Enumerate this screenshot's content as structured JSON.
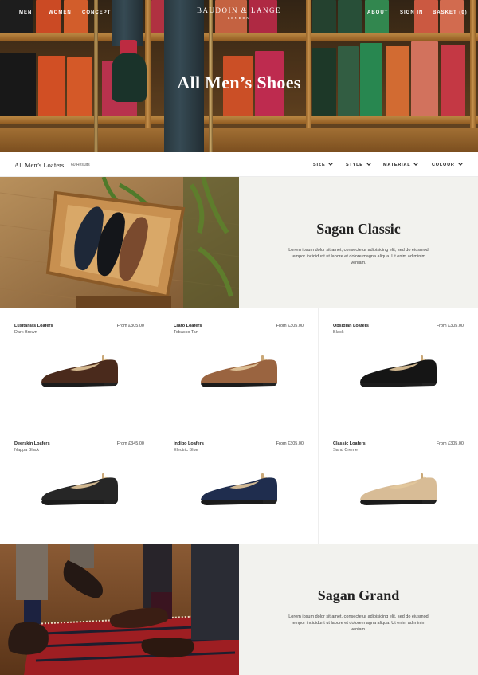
{
  "nav": {
    "left": [
      "MEN",
      "WOMEN",
      "CONCEPT"
    ],
    "right": [
      "ABOUT",
      "SIGN IN",
      "BASKET (0)"
    ],
    "brand_name": "BAUDOIN & LANGE",
    "brand_sub": "LONDON"
  },
  "hero": {
    "title": "All Men’s Shoes"
  },
  "filterbar": {
    "heading": "All Men’s Loafers",
    "count": "60 Results",
    "filters": [
      "SIZE",
      "STYLE",
      "MATERIAL",
      "COLOUR"
    ]
  },
  "features": [
    {
      "title": "Sagan Classic",
      "description": "Lorem ipsum dolor sit amet, consectetur adipisicing elit, sed do eiusmod tempor incididunt ut labore et dolore magna aliqua. Ut enim ad minim veniam."
    },
    {
      "title": "Sagan Grand",
      "description": "Lorem ipsum dolor sit amet, consectetur adipisicing elit, sed do eiusmod tempor incididunt ut labore et dolore magna aliqua. Ut enim ad minim veniam."
    }
  ],
  "products": [
    {
      "name": "Lusitanias Loafers",
      "color": "Dark Brown",
      "price": "From £305.00",
      "swatch": "#4a2a1c"
    },
    {
      "name": "Claro Loafers",
      "color": "Tobacco Tan",
      "price": "From £305.00",
      "swatch": "#9a6440"
    },
    {
      "name": "Obsidian Loafers",
      "color": "Black",
      "price": "From £305.00",
      "swatch": "#151515"
    },
    {
      "name": "Deerskin Loafers",
      "color": "Nappa Black",
      "price": "From £345.00",
      "swatch": "#262626"
    },
    {
      "name": "Indigo Loafers",
      "color": "Electric Blue",
      "price": "From £305.00",
      "swatch": "#1f2d4e"
    },
    {
      "name": "Classic Loafers",
      "color": "Sand Creme",
      "price": "From £305.00",
      "swatch": "#d8bc96"
    }
  ]
}
